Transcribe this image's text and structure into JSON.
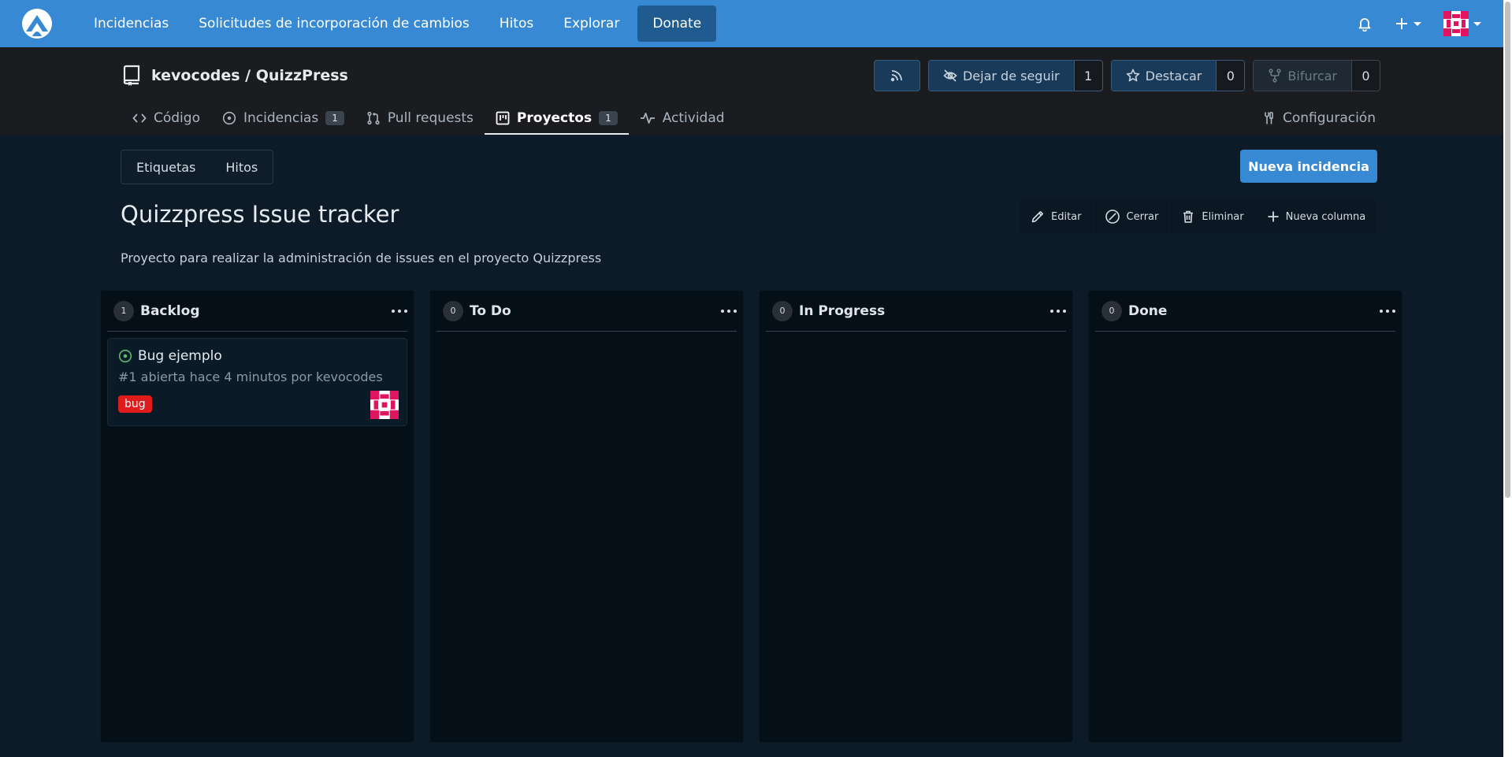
{
  "navbar": {
    "items": [
      "Incidencias",
      "Solicitudes de incorporación de cambios",
      "Hitos",
      "Explorar"
    ],
    "donate": "Donate"
  },
  "repo": {
    "owner_name": "kevocodes / QuizzPress",
    "unwatch": {
      "label": "Dejar de seguir",
      "count": "1"
    },
    "star": {
      "label": "Destacar",
      "count": "0"
    },
    "fork": {
      "label": "Bifurcar",
      "count": "0"
    },
    "tabs": {
      "code": "Código",
      "issues": "Incidencias",
      "issues_count": "1",
      "pulls": "Pull requests",
      "projects": "Proyectos",
      "projects_count": "1",
      "activity": "Actividad"
    },
    "settings": "Configuración"
  },
  "subnav": {
    "labels": "Etiquetas",
    "milestones": "Hitos"
  },
  "new_issue": "Nueva incidencia",
  "project": {
    "title": "Quizzpress Issue tracker",
    "description": "Proyecto para realizar la administración de issues en el proyecto Quizzpress",
    "actions": {
      "edit": "Editar",
      "close": "Cerrar",
      "delete": "Eliminar",
      "new_column": "Nueva columna"
    }
  },
  "columns": [
    {
      "title": "Backlog",
      "count": "1"
    },
    {
      "title": "To Do",
      "count": "0"
    },
    {
      "title": "In Progress",
      "count": "0"
    },
    {
      "title": "Done",
      "count": "0"
    }
  ],
  "card": {
    "title": "Bug ejemplo",
    "meta": "#1 abierta hace 4 minutos por kevocodes",
    "label": "bug"
  },
  "colors": {
    "accent": "#3689d2",
    "header_bg": "#1a1c1f",
    "page_bg": "#0d1a27",
    "column_bg": "#040f18",
    "bug_label": "#e01b1b",
    "open_issue": "#5fbb6b",
    "avatar": "#e0155f"
  }
}
